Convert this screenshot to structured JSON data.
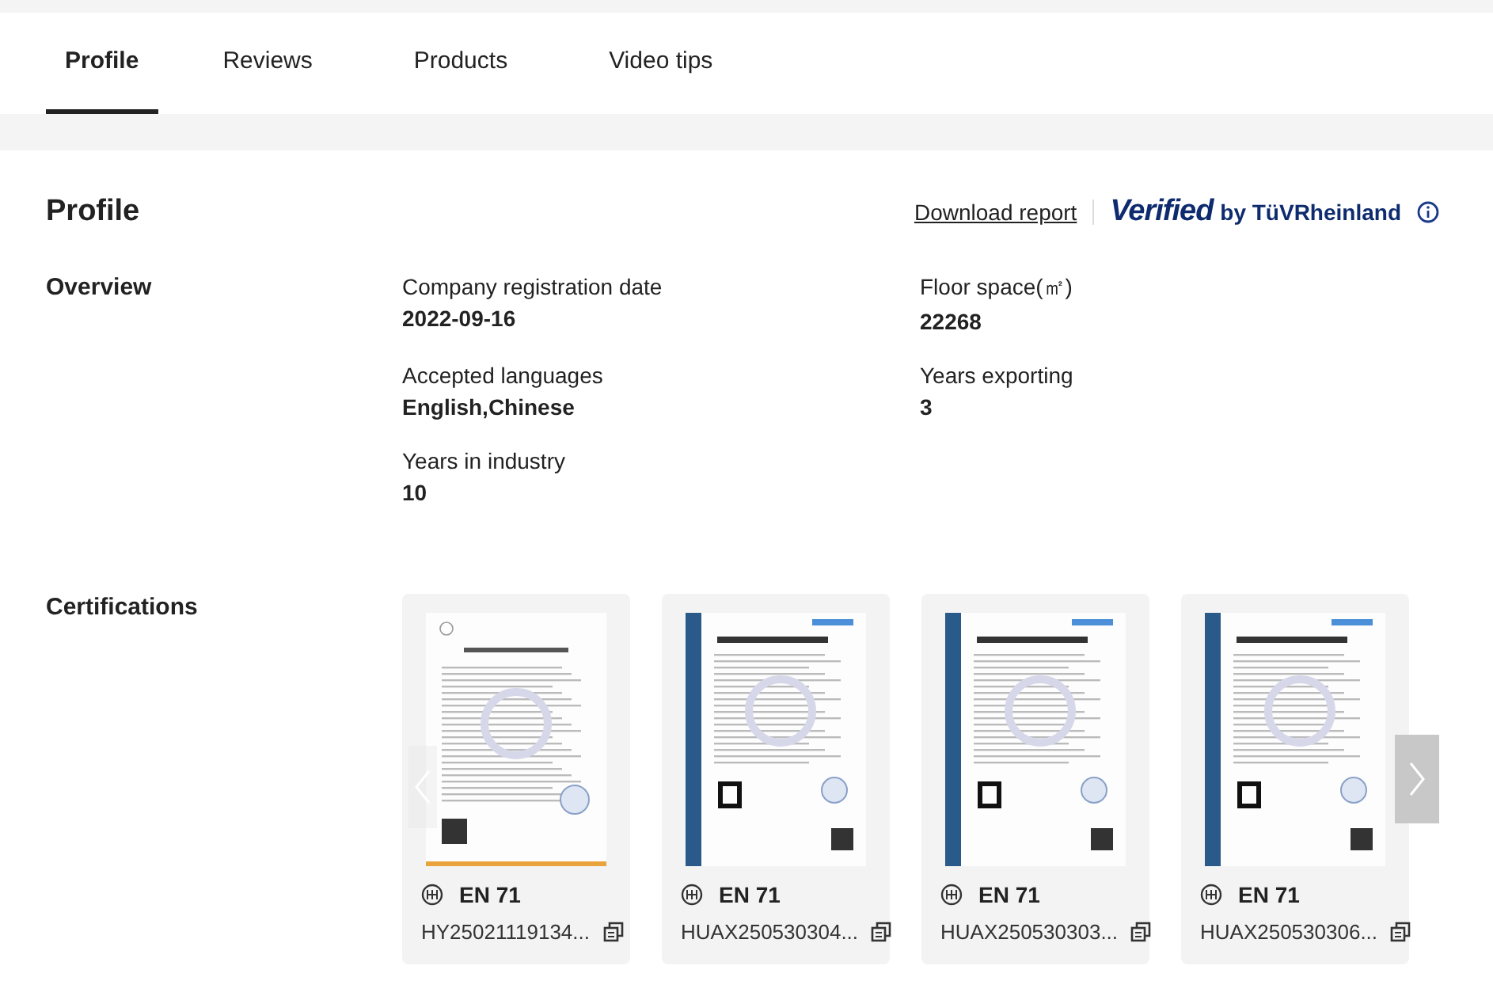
{
  "tabs": [
    {
      "label": "Profile",
      "selected": true
    },
    {
      "label": "Reviews",
      "selected": false
    },
    {
      "label": "Products",
      "selected": false
    },
    {
      "label": "Video tips",
      "selected": false
    }
  ],
  "profile": {
    "title": "Profile",
    "download_link": "Download report",
    "verified": {
      "word": "Verified",
      "by": "by TüVRheinland"
    }
  },
  "overview": {
    "heading": "Overview",
    "fields": [
      {
        "label": "Company registration date",
        "value": "2022-09-16"
      },
      {
        "label": "Floor space(㎡)",
        "value": "22268"
      },
      {
        "label": "Accepted languages",
        "value": "English,Chinese"
      },
      {
        "label": "Years exporting",
        "value": "3"
      },
      {
        "label": "Years in industry",
        "value": "10"
      }
    ]
  },
  "certifications": {
    "heading": "Certifications",
    "items": [
      {
        "kind": "declaration",
        "name": "EN 71",
        "number": "HY25021119134..."
      },
      {
        "kind": "certificate",
        "name": "EN 71",
        "number": "HUAX250530304..."
      },
      {
        "kind": "certificate",
        "name": "EN 71",
        "number": "HUAX250530303..."
      },
      {
        "kind": "certificate",
        "name": "EN 71",
        "number": "HUAX250530306..."
      }
    ]
  }
}
